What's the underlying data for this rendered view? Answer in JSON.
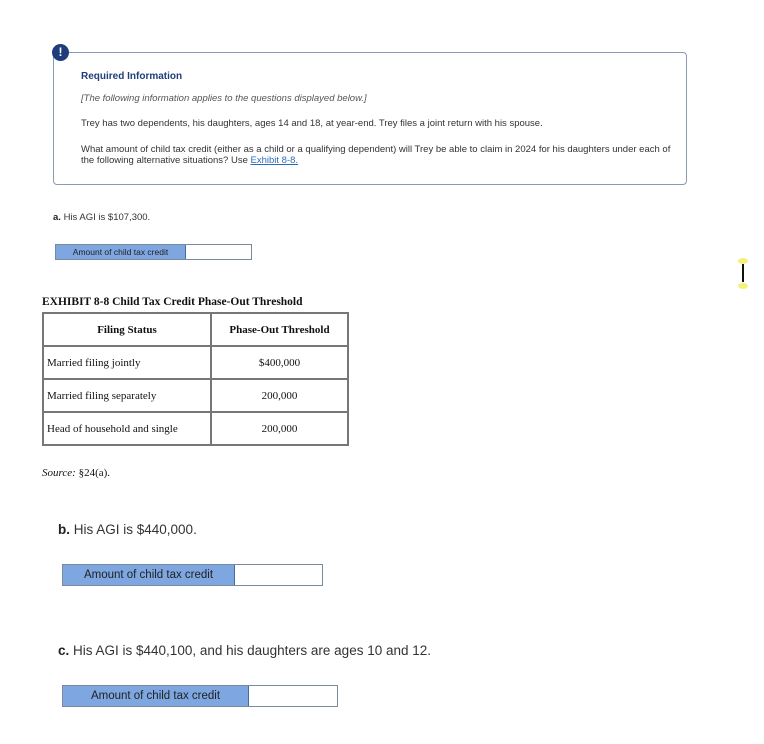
{
  "required_info": {
    "icon": "alert-exclamation-icon",
    "icon_glyph": "!",
    "title": "Required Information",
    "note": "[The following information applies to the questions displayed below.]",
    "paragraph1": "Trey has two dependents, his daughters, ages 14 and 18, at year-end. Trey files a joint return with his spouse.",
    "paragraph2": "What amount of child tax credit (either as a child or a qualifying dependent) will Trey be able to claim in 2024 for his daughters under each of the following alternative situations? Use ",
    "exhibit_link": "Exhibit 8-8."
  },
  "questions": [
    {
      "letter": "a.",
      "text": " His AGI is $107,300.",
      "answer_label": "Amount of child tax credit",
      "answer_value": ""
    },
    {
      "letter": "b.",
      "text": " His AGI is $440,000.",
      "answer_label": "Amount of child tax credit",
      "answer_value": ""
    },
    {
      "letter": "c.",
      "text": " His AGI is $440,100, and his daughters are ages 10 and 12.",
      "answer_label": "Amount of child tax credit",
      "answer_value": ""
    }
  ],
  "exhibit": {
    "title": "EXHIBIT 8-8 Child Tax Credit Phase-Out Threshold",
    "headers": [
      "Filing Status",
      "Phase-Out Threshold"
    ],
    "rows": [
      [
        "Married filing jointly",
        "$400,000"
      ],
      [
        "Married filing separately",
        "200,000"
      ],
      [
        "Head of household and single",
        "200,000"
      ]
    ],
    "source_label": "Source:",
    "source_text": " §24(a)."
  },
  "colors": {
    "accent": "#1f3d7a",
    "answer_label_bg": "#7ea6e0",
    "link": "#2a6ebb"
  }
}
